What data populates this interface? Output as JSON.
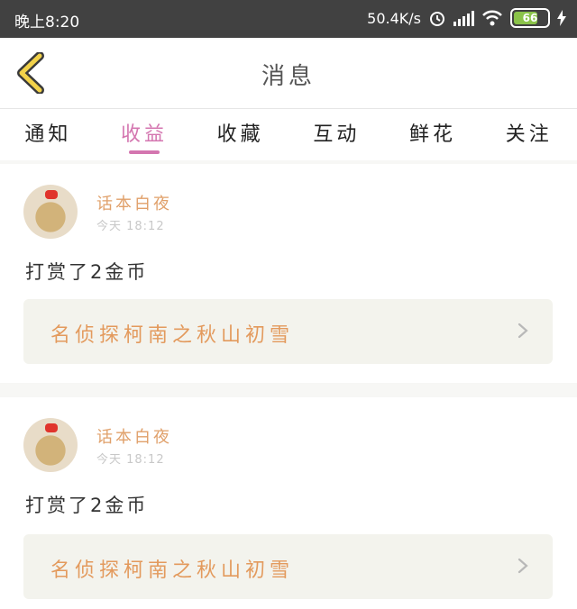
{
  "status_bar": {
    "time": "晚上8:20",
    "speed": "50.4K/s",
    "battery": "66",
    "icons": [
      "alarm-icon",
      "signal-icon",
      "wifi-icon",
      "battery-icon",
      "charging-icon"
    ]
  },
  "header": {
    "back_icon": "chevron-left-icon",
    "title": "消息"
  },
  "tabs": [
    {
      "label": "通知",
      "active": false
    },
    {
      "label": "收益",
      "active": true
    },
    {
      "label": "收藏",
      "active": false
    },
    {
      "label": "互动",
      "active": false
    },
    {
      "label": "鲜花",
      "active": false
    },
    {
      "label": "关注",
      "active": false
    }
  ],
  "messages": [
    {
      "username": "话本白夜",
      "time": "今天 18:12",
      "content": "打赏了2金币",
      "work_title": "名侦探柯南之秋山初雪"
    },
    {
      "username": "话本白夜",
      "time": "今天 18:12",
      "content": "打赏了2金币",
      "work_title": "名侦探柯南之秋山初雪"
    }
  ],
  "colors": {
    "accent": "#d476b0",
    "username": "#e0a06a",
    "work_title": "#e39a5d",
    "back_icon": "#f2d24a"
  }
}
